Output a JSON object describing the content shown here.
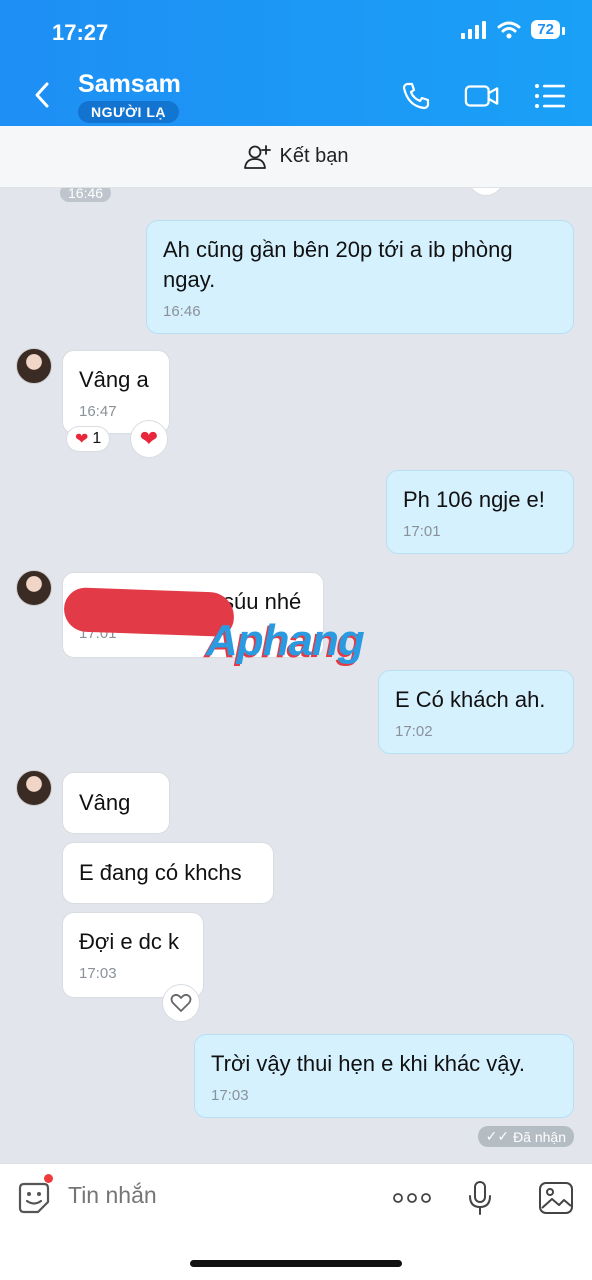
{
  "status_bar": {
    "time": "17:27",
    "battery": "72"
  },
  "header": {
    "name": "Samsam",
    "badge": "NGƯỜI LẠ"
  },
  "friend_bar": {
    "label": "Kết bạn"
  },
  "messages": [
    {
      "dir": "out",
      "text": "Ah cũng gần bên 20p tới a ib phòng ngay.",
      "time": "16:46"
    },
    {
      "dir": "in",
      "text": "Vâng a",
      "time": "16:47",
      "reaction": "1"
    },
    {
      "dir": "out",
      "text": "Ph 106 ngje e!",
      "time": "17:01"
    },
    {
      "dir": "in",
      "text": "súu nhé",
      "time": "17:01"
    },
    {
      "dir": "out",
      "text": "E Có khách ah.",
      "time": "17:02"
    },
    {
      "dir": "in",
      "text": "Vâng"
    },
    {
      "dir": "in",
      "text": "E đang có khchs"
    },
    {
      "dir": "in",
      "text": "Đợi e dc k",
      "time": "17:03"
    },
    {
      "dir": "out",
      "text": "Trời vậy thui hẹn e khi khác vậy.",
      "time": "17:03"
    }
  ],
  "top_time_chip": "16:46",
  "delivery_status": "Đã nhận",
  "watermark": "Aphang",
  "input": {
    "placeholder": "Tin nhắn"
  },
  "colors": {
    "header": "#1e8ff5",
    "outgoing": "#d5f1fe",
    "incoming": "#ffffff",
    "accent_red": "#e23a46"
  }
}
